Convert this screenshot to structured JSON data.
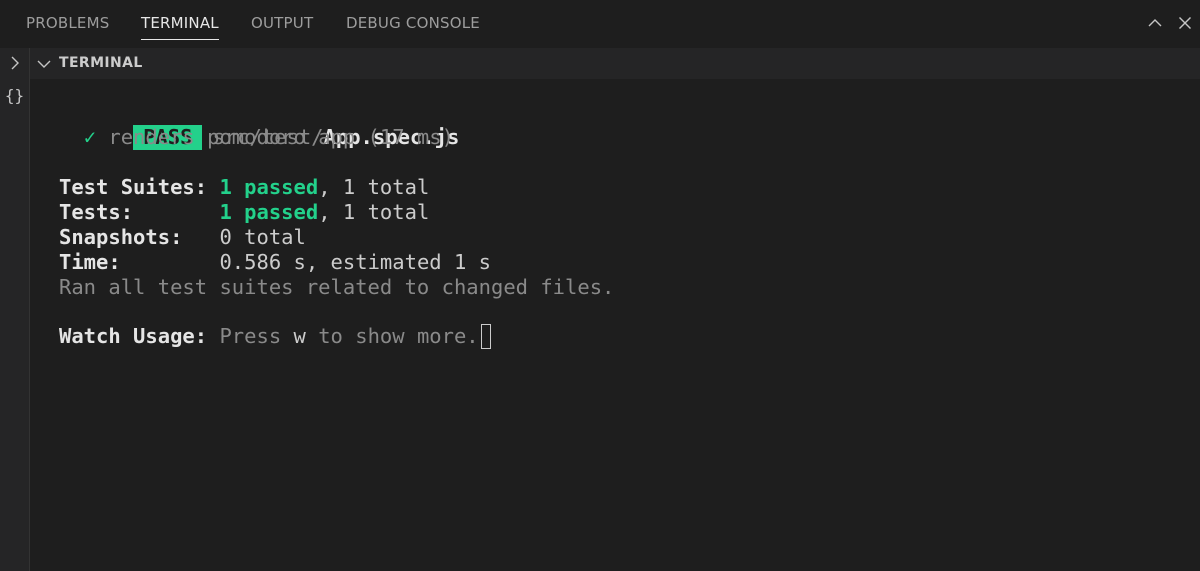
{
  "tabs": [
    {
      "label": "PROBLEMS",
      "active": false
    },
    {
      "label": "TERMINAL",
      "active": true
    },
    {
      "label": "OUTPUT",
      "active": false
    },
    {
      "label": "DEBUG CONSOLE",
      "active": false
    }
  ],
  "window_controls": {
    "maximize_icon": "chevron-up-icon",
    "close_icon": "close-icon"
  },
  "left_strip": {
    "icons": [
      "chevron-right-icon",
      "braces-icon"
    ],
    "braces_glyph": "{}",
    "chevron_glyph": ">"
  },
  "section": {
    "title": "TERMINAL",
    "chevron_icon": "chevron-down-icon"
  },
  "terminal": {
    "pass_badge": "PASS",
    "test_file_dir": "src/test/",
    "test_file_name": "App.spec.js",
    "check_mark": "✓",
    "test_case": "renders pomodoro app (17 ms)",
    "suites_label": "Test Suites:",
    "suites_passed": "1 passed",
    "suites_total": ", 1 total",
    "tests_label": "Tests:",
    "tests_passed": "1 passed",
    "tests_total": ", 1 total",
    "snapshots_label": "Snapshots:",
    "snapshots_value": "0 total",
    "time_label": "Time:",
    "time_value": "0.586 s, estimated 1 s",
    "ran_all": "Ran all test suites related to changed files.",
    "watch_label": "Watch Usage:",
    "watch_press": " Press ",
    "watch_key": "w",
    "watch_rest": " to show more."
  },
  "colors": {
    "background": "#1e1e1e",
    "pass_green": "#23d18b",
    "panel": "#252526"
  }
}
